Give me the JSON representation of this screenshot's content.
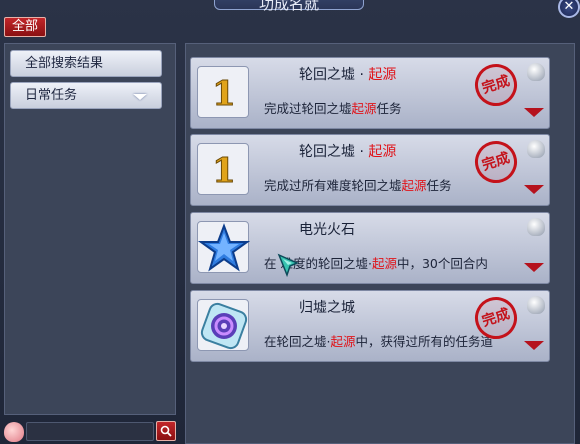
{
  "window": {
    "title": "功成名就"
  },
  "filter": {
    "all_label": "全部"
  },
  "sidebar": {
    "items": [
      {
        "label": "全部搜索结果"
      },
      {
        "label": "日常任务"
      }
    ]
  },
  "search": {
    "value": "",
    "placeholder": ""
  },
  "achievements": [
    {
      "icon_text": "1",
      "name": "轮回之墟",
      "name_sep": "·",
      "name_sub": "起源",
      "desc_pre": "完成过轮回之墟",
      "desc_hl": "起源",
      "desc_post": "任务",
      "stamp": "完成"
    },
    {
      "icon_text": "1",
      "name": "轮回之墟",
      "name_sep": "·",
      "name_sub": "起源",
      "desc_pre": "完成过所有难度轮回之墟",
      "desc_hl": "起源",
      "desc_post": "任务",
      "stamp": "完成"
    },
    {
      "icon_text": "",
      "name": "电光火石",
      "name_sep": "",
      "name_sub": "",
      "desc_pre": "在  难度的轮回之墟·",
      "desc_hl": "起源",
      "desc_post": "中，30个回合内",
      "stamp": ""
    },
    {
      "icon_text": "",
      "name": "归墟之城",
      "name_sep": "",
      "name_sub": "",
      "desc_pre": "在轮回之墟·",
      "desc_hl": "起源",
      "desc_post": "中，获得过所有的任务道",
      "stamp": "完成"
    }
  ],
  "colors": {
    "accent_red": "#e0141a",
    "panel": "#3c4559"
  }
}
